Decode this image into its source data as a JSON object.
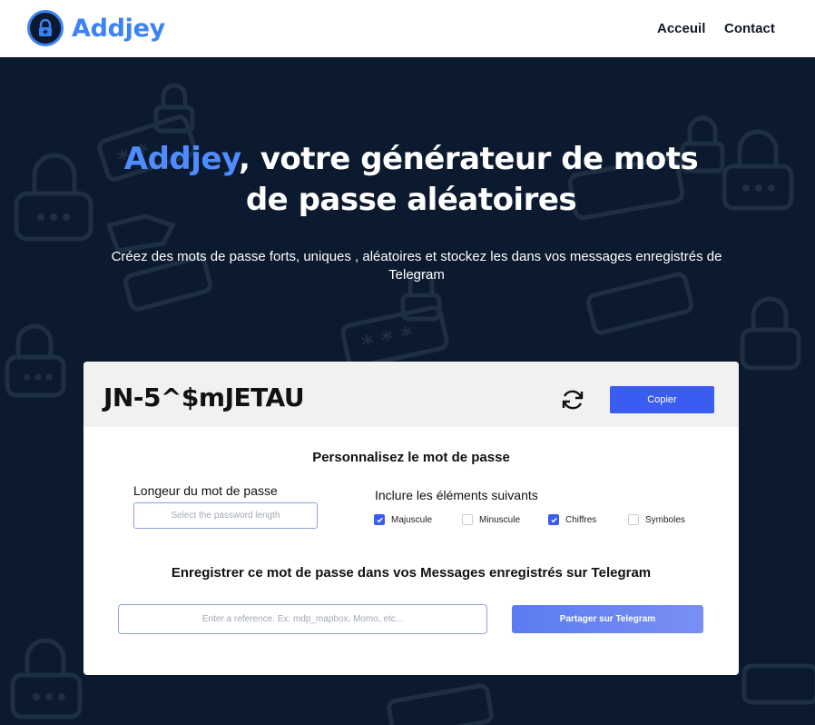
{
  "brand": {
    "name": "Addjey",
    "logo_icon": "lock-icon",
    "accent_color": "#3b82f6"
  },
  "nav": {
    "home": "Acceuil",
    "contact": "Contact"
  },
  "hero": {
    "title_brand": "Addjey",
    "title_line1_rest": ", votre générateur de mots",
    "title_line2": "de passe aléatoires",
    "subtitle": "Créez des mots de passe forts, uniques , aléatoires et stockez les dans vos messages enregistrés de Telegram",
    "background_color": "#0b1a2e"
  },
  "generator": {
    "password": "JN-5^$mJETAU",
    "refresh_icon": "refresh-icon",
    "copy_label": "Copier"
  },
  "customize": {
    "title": "Personnalisez le mot de passe",
    "length_label": "Longeur du mot de passe",
    "length_placeholder": "Select the password length",
    "include_label": "Inclure les éléments suivants",
    "options": [
      {
        "label": "Majuscule",
        "checked": true
      },
      {
        "label": "Minuscule",
        "checked": false
      },
      {
        "label": "Chiffres",
        "checked": true
      },
      {
        "label": "Symboles",
        "checked": false
      }
    ]
  },
  "telegram": {
    "title": "Enregistrer ce mot de passe dans vos Messages enregistrés sur Telegram",
    "reference_placeholder": "Enter a reference. Ex: mdp_mapbox, Momo, etc...",
    "share_label": "Partager sur Telegram",
    "button_color": "#5a7cf0"
  }
}
